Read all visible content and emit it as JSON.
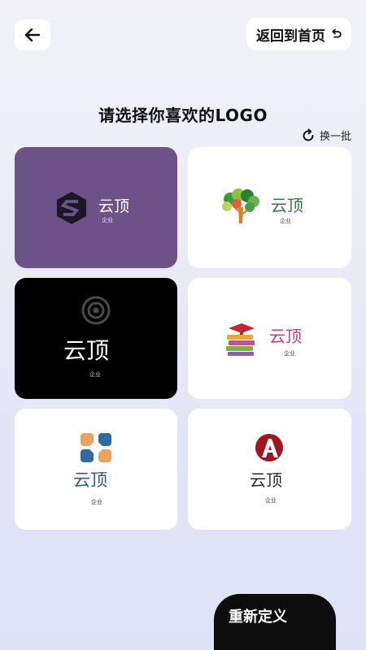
{
  "header": {
    "back_icon": "arrow-left-icon",
    "home_label": "返回到首页",
    "home_icon": "return-arrow-icon"
  },
  "main": {
    "title": "请选择你喜欢的LOGO",
    "refresh_label": "换一批",
    "refresh_icon": "refresh-icon"
  },
  "logos": [
    {
      "brand": "云顶",
      "sub": "企业",
      "bg": "#6d5288",
      "mark": "hexagon-s-icon"
    },
    {
      "brand": "云顶",
      "sub": "企业",
      "bg": "#ffffff",
      "mark": "tree-icon"
    },
    {
      "brand": "云顶",
      "sub": "企业",
      "bg": "#000000",
      "mark": "target-circle-icon"
    },
    {
      "brand": "云顶",
      "sub": "企业",
      "bg": "#ffffff",
      "mark": "books-icon"
    },
    {
      "brand": "云顶",
      "sub": "企业",
      "bg": "#ffffff",
      "mark": "knot-icon"
    },
    {
      "brand": "云顶",
      "sub": "企业",
      "bg": "#ffffff",
      "mark": "letter-a-icon"
    }
  ],
  "footer": {
    "customize_label": "重新定义"
  },
  "colors": {
    "purple": "#6d5288",
    "green_text": "#2f7a3e",
    "pink_text": "#c23d6e",
    "blue_text": "#2f5d8a",
    "red_mark": "#a3161d"
  }
}
